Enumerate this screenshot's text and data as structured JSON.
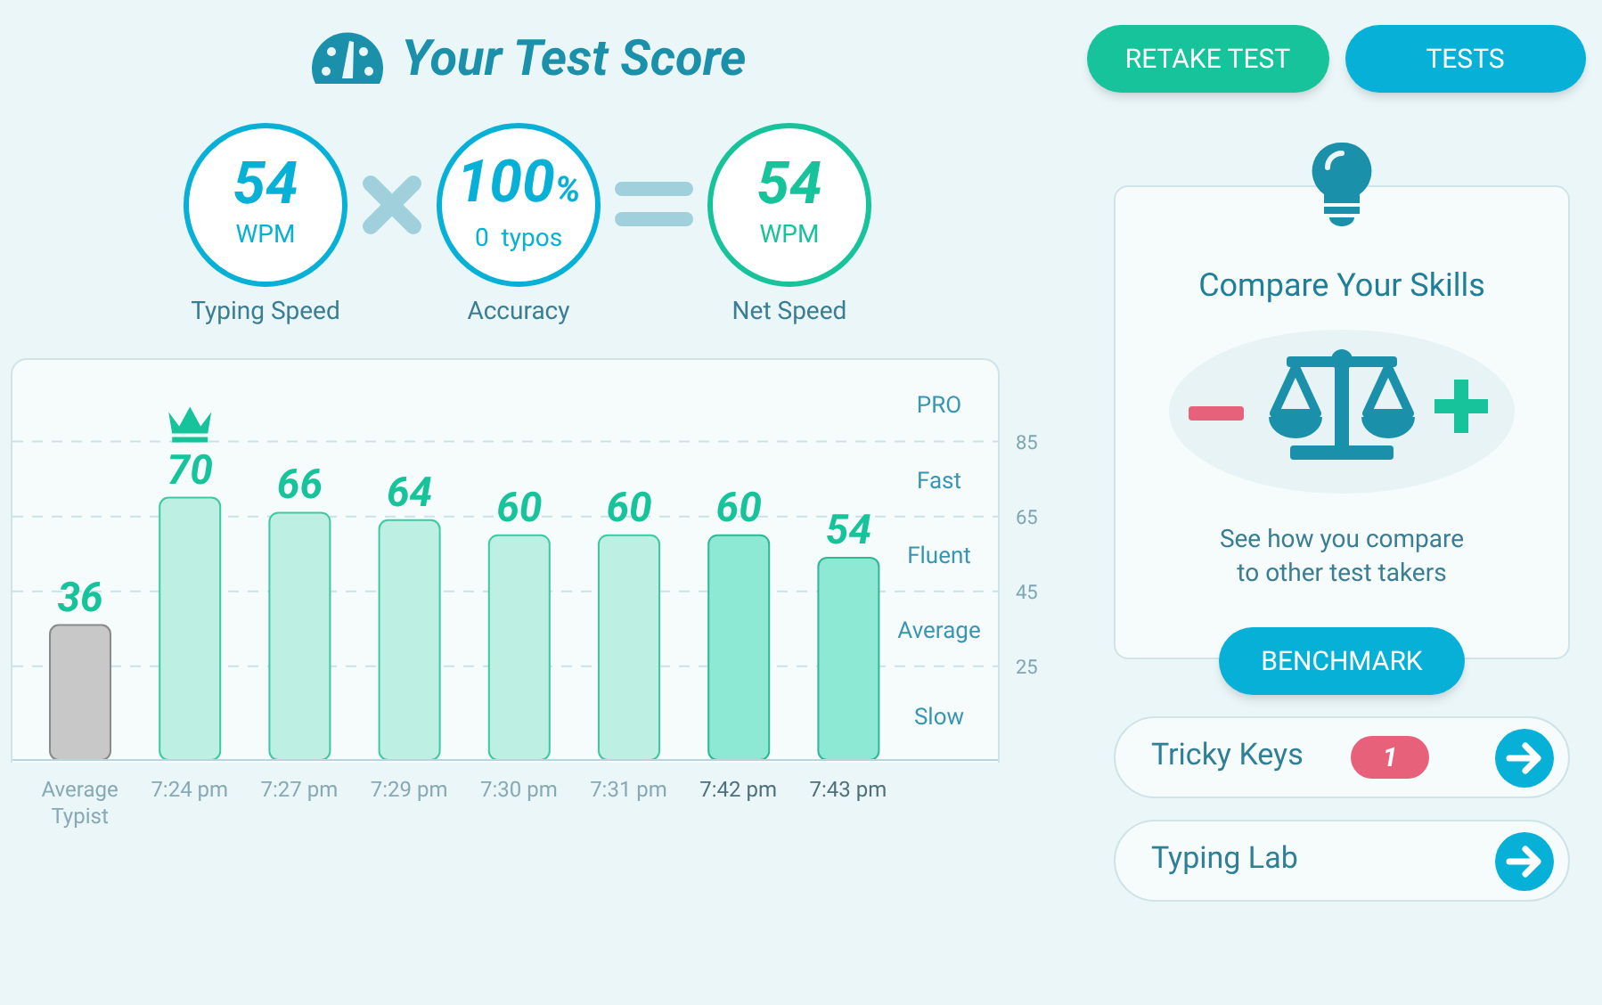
{
  "header": {
    "title": "Your Test Score"
  },
  "scores": [
    {
      "kind": "speed",
      "value": "54",
      "unit": "WPM",
      "label": "Typing Speed"
    },
    {
      "kind": "times"
    },
    {
      "kind": "accuracy",
      "value": "100",
      "suffix": "%",
      "unit": "0  typos",
      "label": "Accuracy"
    },
    {
      "kind": "equals"
    },
    {
      "kind": "net",
      "value": "54",
      "unit": "WPM",
      "label": "Net Speed"
    }
  ],
  "history": {
    "bars": [
      {
        "kind": "average"
      },
      {
        "kind": "past"
      },
      {
        "kind": "past"
      },
      {
        "kind": "past"
      },
      {
        "kind": "past"
      },
      {
        "kind": "past"
      },
      {
        "kind": "recent"
      },
      {
        "kind": "recent"
      }
    ],
    "chart_data": {
      "type": "bar",
      "categories": [
        "Average Typist",
        "7:24 pm",
        "7:27 pm",
        "7:29 pm",
        "7:30 pm",
        "7:31 pm",
        "7:42 pm",
        "7:43 pm"
      ],
      "values": [
        36,
        70,
        66,
        64,
        60,
        60,
        60,
        54
      ],
      "ylim": [
        0,
        107
      ],
      "yticks": [
        25,
        45,
        65,
        85
      ],
      "grid": true,
      "data_labels": true,
      "annotations": [
        "PRO",
        "Fast",
        "Fluent",
        "Average",
        "Slow"
      ]
    }
  },
  "buttons": [
    {
      "kind": "green",
      "label": "RETAKE TEST"
    },
    {
      "kind": "blue",
      "label": "TESTS"
    }
  ],
  "compare_card": {
    "title": "Compare Your Skills",
    "text": "See how you compare\nto other test takers",
    "button": "BENCHMARK"
  },
  "links": [
    {
      "label": "Tricky Keys",
      "badge": "1"
    },
    {
      "label": "Typing Lab"
    }
  ]
}
